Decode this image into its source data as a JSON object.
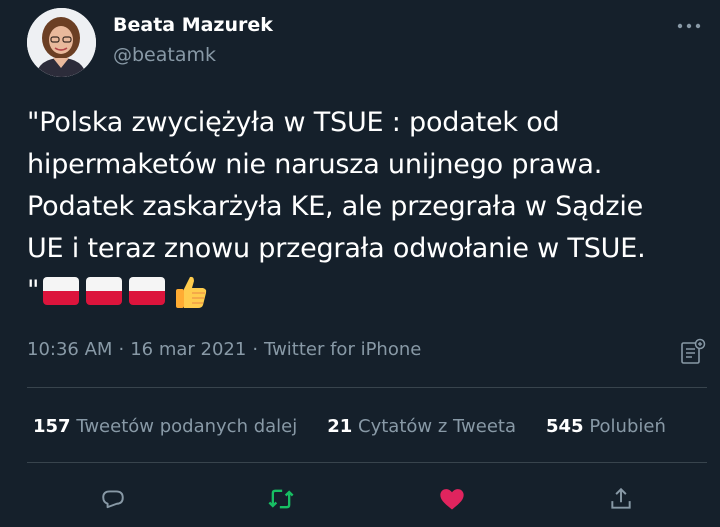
{
  "author": {
    "display_name": "Beata Mazurek",
    "handle": "@beatamk"
  },
  "tweet": {
    "lines": [
      "\"Polska zwyciężyła w TSUE : podatek od",
      "hipermaketów nie narusza unijnego prawa.",
      "Podatek zaskarżyła KE, ale przegrała w Sądzie",
      "UE i teraz znowu przegrała odwołanie w TSUE."
    ],
    "closing_quote": "\"",
    "emojis": [
      "flag-poland",
      "flag-poland",
      "flag-poland",
      "thumbs-up"
    ]
  },
  "meta": {
    "time": "10:36 AM",
    "separator": "·",
    "date": "16 mar 2021",
    "source": "Twitter for iPhone"
  },
  "stats": {
    "retweets": {
      "count": "157",
      "label": "Tweetów podanych dalej"
    },
    "quotes": {
      "count": "21",
      "label": "Cytatów z Tweeta"
    },
    "likes": {
      "count": "545",
      "label": "Polubień"
    }
  },
  "actions": {
    "reply_icon": "reply-icon",
    "retweet_icon": "retweet-icon",
    "like_icon": "heart-icon",
    "share_icon": "share-icon"
  },
  "colors": {
    "background": "#15202b",
    "secondary_text": "#8899a6",
    "divider": "#38444d",
    "retweet_active": "#17bf63",
    "like_active": "#e0245e"
  }
}
